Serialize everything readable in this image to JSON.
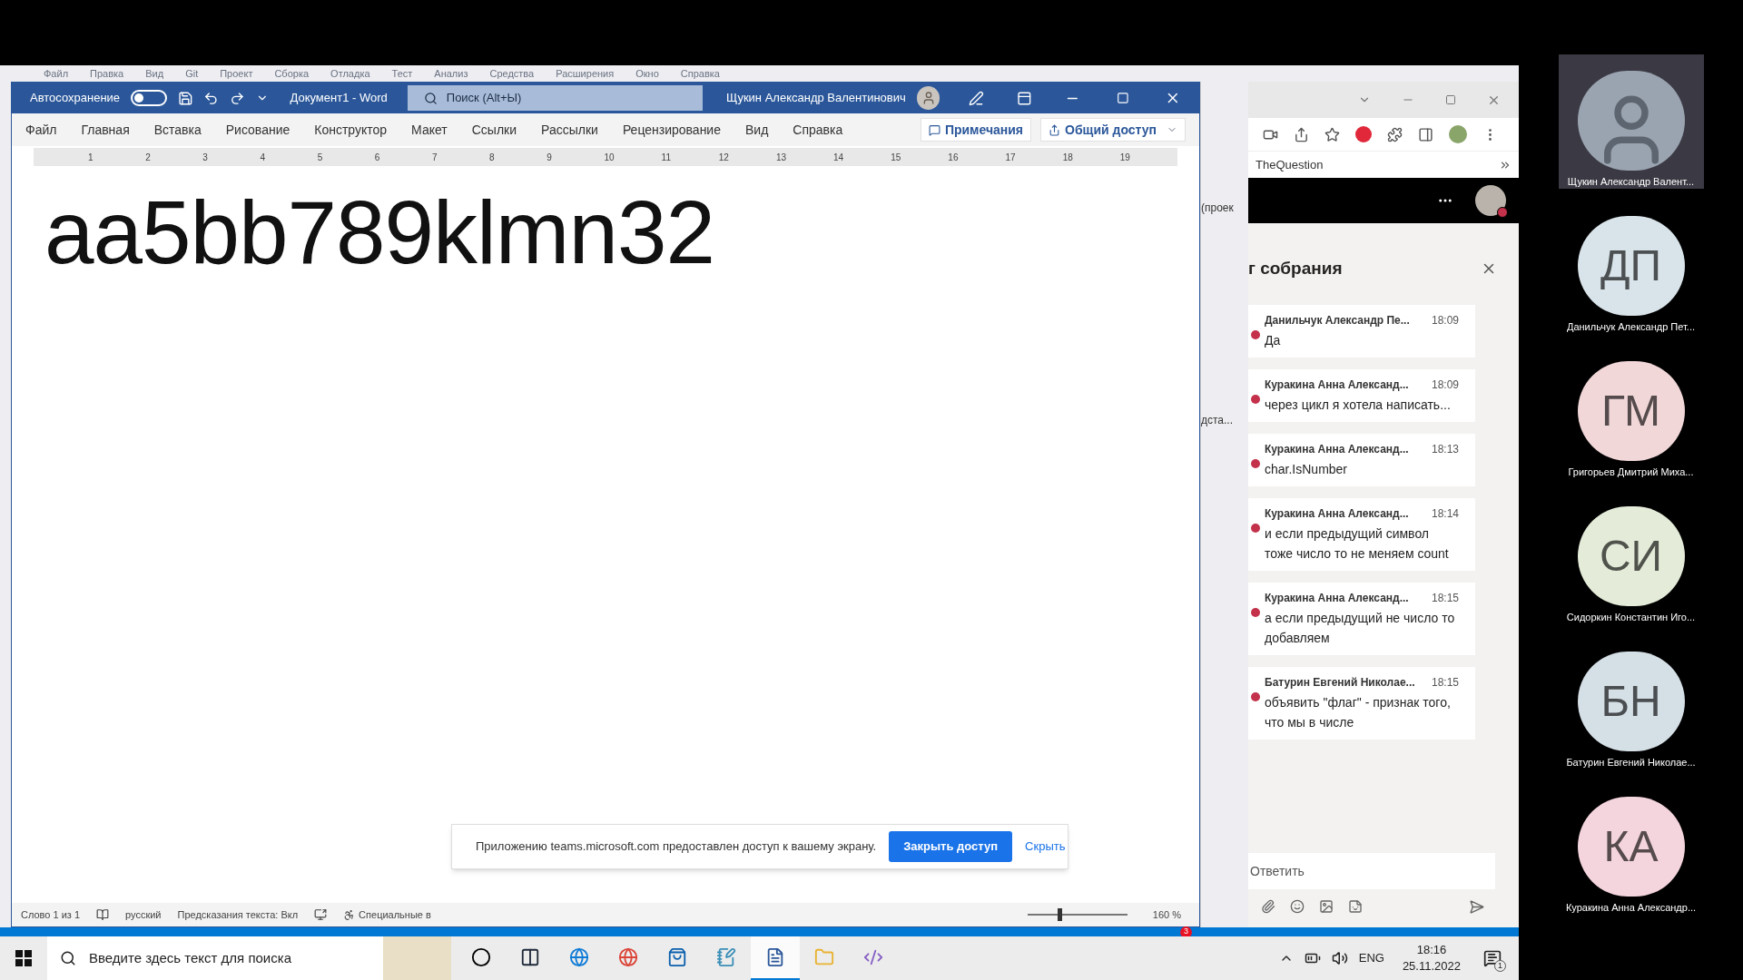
{
  "background_app_menu": [
    "Файл",
    "Правка",
    "Вид",
    "Git",
    "Проект",
    "Сборка",
    "Отладка",
    "Тест",
    "Анализ",
    "Средства",
    "Расширения",
    "Окно",
    "Справка"
  ],
  "word": {
    "autosave_label": "Автосохранение",
    "autosave_on": false,
    "doc_title": "Документ1 - Word",
    "search_placeholder": "Поиск (Alt+Ы)",
    "user": "Щукин Александр Валентинович",
    "tabs": [
      "Файл",
      "Главная",
      "Вставка",
      "Рисование",
      "Конструктор",
      "Макет",
      "Ссылки",
      "Рассылки",
      "Рецензирование",
      "Вид",
      "Справка"
    ],
    "comments_button": "Примечания",
    "share_button": "Общий доступ",
    "ruler": [
      "1",
      "2",
      "3",
      "4",
      "5",
      "6",
      "7",
      "8",
      "9",
      "10",
      "11",
      "12",
      "13",
      "14",
      "15",
      "16",
      "17",
      "18",
      "19"
    ],
    "document_text": "aa5bb789klmn32",
    "status": [
      "Слово 1 из 1",
      "русский",
      "Предсказания текста: Вкл",
      "Специальные в"
    ],
    "zoom_slider": {
      "level": 0.3
    },
    "zoom": "160 %",
    "badge": "3"
  },
  "side_pane": [
    "(проек",
    "дста..."
  ],
  "browser": {
    "bookmark": "TheQuestion",
    "chat": {
      "title": "г собрания",
      "messages": [
        {
          "author": "Данильчук Александр Пе...",
          "time": "18:09",
          "text": "Да"
        },
        {
          "author": "Куракина Анна Александ...",
          "time": "18:09",
          "text": "через цикл я хотела написать..."
        },
        {
          "author": "Куракина Анна Александ...",
          "time": "18:13",
          "text": "char.IsNumber"
        },
        {
          "author": "Куракина Анна Александ...",
          "time": "18:14",
          "text": "и если предыдущий символ тоже число то не меняем count"
        },
        {
          "author": "Куракина Анна Александ...",
          "time": "18:15",
          "text": "а если предыдущий не число то добавляем"
        },
        {
          "author": "Батурин Евгений Николае...",
          "time": "18:15",
          "text": "объявить \"флаг\" - признак того, что мы в числе"
        }
      ],
      "reply_placeholder": "Ответить"
    }
  },
  "toast": {
    "text": "Приложению teams.microsoft.com предоставлен доступ к вашему экрану.",
    "button": "Закрыть доступ",
    "link": "Скрыть"
  },
  "taskbar": {
    "search_placeholder": "Введите здесь текст для поиска",
    "apps": [
      {
        "kind": "cortana",
        "selected": false
      },
      {
        "kind": "taskview",
        "selected": false
      },
      {
        "kind": "edge",
        "selected": false
      },
      {
        "kind": "chrome",
        "selected": false
      },
      {
        "kind": "store",
        "selected": false
      },
      {
        "kind": "notepad",
        "selected": false
      },
      {
        "kind": "word",
        "selected": true
      },
      {
        "kind": "explorer",
        "selected": false
      },
      {
        "kind": "vs",
        "selected": false
      }
    ],
    "language": "ENG",
    "time": "18:16",
    "date": "25.11.2022",
    "notifications": "1"
  },
  "participants": [
    {
      "kind": "photo",
      "name": "Щукин Александр Валент...",
      "selected": true
    },
    {
      "kind": "initials",
      "initials": "ДП",
      "name": "Данильчук Александр Пет...",
      "color": "#d9e4ea",
      "selected": false
    },
    {
      "kind": "initials",
      "initials": "ГМ",
      "name": "Григорьев Дмитрий Миха...",
      "color": "#f2d7d9",
      "selected": false
    },
    {
      "kind": "initials",
      "initials": "СИ",
      "name": "Сидоркин Константин Иго...",
      "color": "#e4ecd9",
      "selected": false
    },
    {
      "kind": "initials",
      "initials": "БН",
      "name": "Батурин Евгений Николае...",
      "color": "#d5dfe6",
      "selected": false
    },
    {
      "kind": "initials",
      "initials": "КА",
      "name": "Куракина Анна Александр...",
      "color": "#f5d5dd",
      "selected": false
    }
  ]
}
